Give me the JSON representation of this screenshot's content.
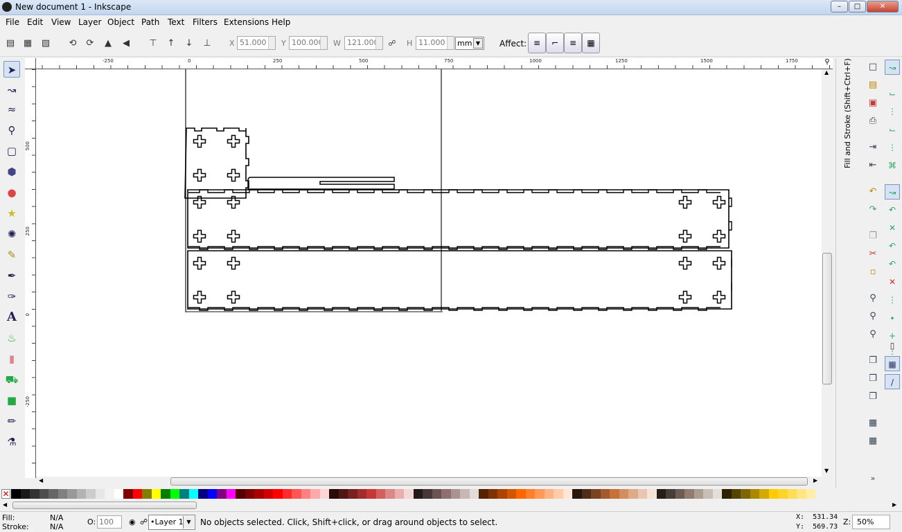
{
  "window": {
    "title": "New document 1 - Inkscape"
  },
  "menu": {
    "items": [
      "File",
      "Edit",
      "View",
      "Layer",
      "Object",
      "Path",
      "Text",
      "Filters",
      "Extensions",
      "Help"
    ]
  },
  "toolbar": {
    "x_label": "X",
    "x_value": "51.000",
    "y_label": "Y",
    "y_value": "100.000",
    "w_label": "W",
    "w_value": "121.000",
    "h_label": "H",
    "h_value": "11.000",
    "unit": "mm",
    "affect_label": "Affect:"
  },
  "ruler": {
    "h_labels": [
      "-250",
      "0",
      "250",
      "500",
      "750",
      "1000",
      "1250",
      "1500",
      "1750"
    ],
    "v_labels": [
      "500",
      "250",
      "0",
      "-250"
    ]
  },
  "dock": {
    "title": "Fill and Stroke (Shift+Ctrl+F)"
  },
  "status": {
    "fill_label": "Fill:",
    "fill_value": "N/A",
    "stroke_label": "Stroke:",
    "stroke_value": "N/A",
    "opacity_label": "O:",
    "opacity_value": "100",
    "layer": "•Layer 1",
    "message": "No objects selected. Click, Shift+click, or drag around objects to select.",
    "x_coord": "X:  531.34",
    "y_coord": "Y:  569.73",
    "zoom_label": "Z:",
    "zoom_value": "50%"
  },
  "palette": [
    "#000000",
    "#1a1a1a",
    "#333333",
    "#4d4d4d",
    "#666666",
    "#808080",
    "#999999",
    "#b3b3b3",
    "#cccccc",
    "#e6e6e6",
    "#f2f2f2",
    "#ffffff",
    "#800000",
    "#ff0000",
    "#808000",
    "#ffff00",
    "#008000",
    "#00ff00",
    "#008080",
    "#00ffff",
    "#000080",
    "#0000ff",
    "#800080",
    "#ff00ff",
    "#550000",
    "#800000",
    "#aa0000",
    "#d40000",
    "#ff0000",
    "#ff2a2a",
    "#ff5555",
    "#ff8080",
    "#ffaaaa",
    "#ffd5d5",
    "#280b0b",
    "#501616",
    "#782121",
    "#a02c2c",
    "#c83737",
    "#d35f5f",
    "#de8787",
    "#e9afaf",
    "#f4d7d7",
    "#241c1c",
    "#483737",
    "#6c5353",
    "#916f6f",
    "#ac9393",
    "#c8b7b7",
    "#e3dbdb",
    "#552200",
    "#803300",
    "#aa4400",
    "#d45500",
    "#ff6600",
    "#ff7f2a",
    "#ff9955",
    "#ffb380",
    "#ffccaa",
    "#ffe6d5",
    "#28170b",
    "#502d16",
    "#784421",
    "#a05a2c",
    "#c87137",
    "#d38d5f",
    "#deaa87",
    "#e9c6af",
    "#f4e3d7",
    "#241f1c",
    "#483e37",
    "#6c5d53",
    "#917c6f",
    "#ac9d93",
    "#c8beb7",
    "#e3dedb",
    "#2b2200",
    "#554400",
    "#806600",
    "#aa8800",
    "#d4aa00",
    "#ffcc00",
    "#ffd42a",
    "#ffdd55",
    "#ffe680",
    "#ffeeaa"
  ]
}
